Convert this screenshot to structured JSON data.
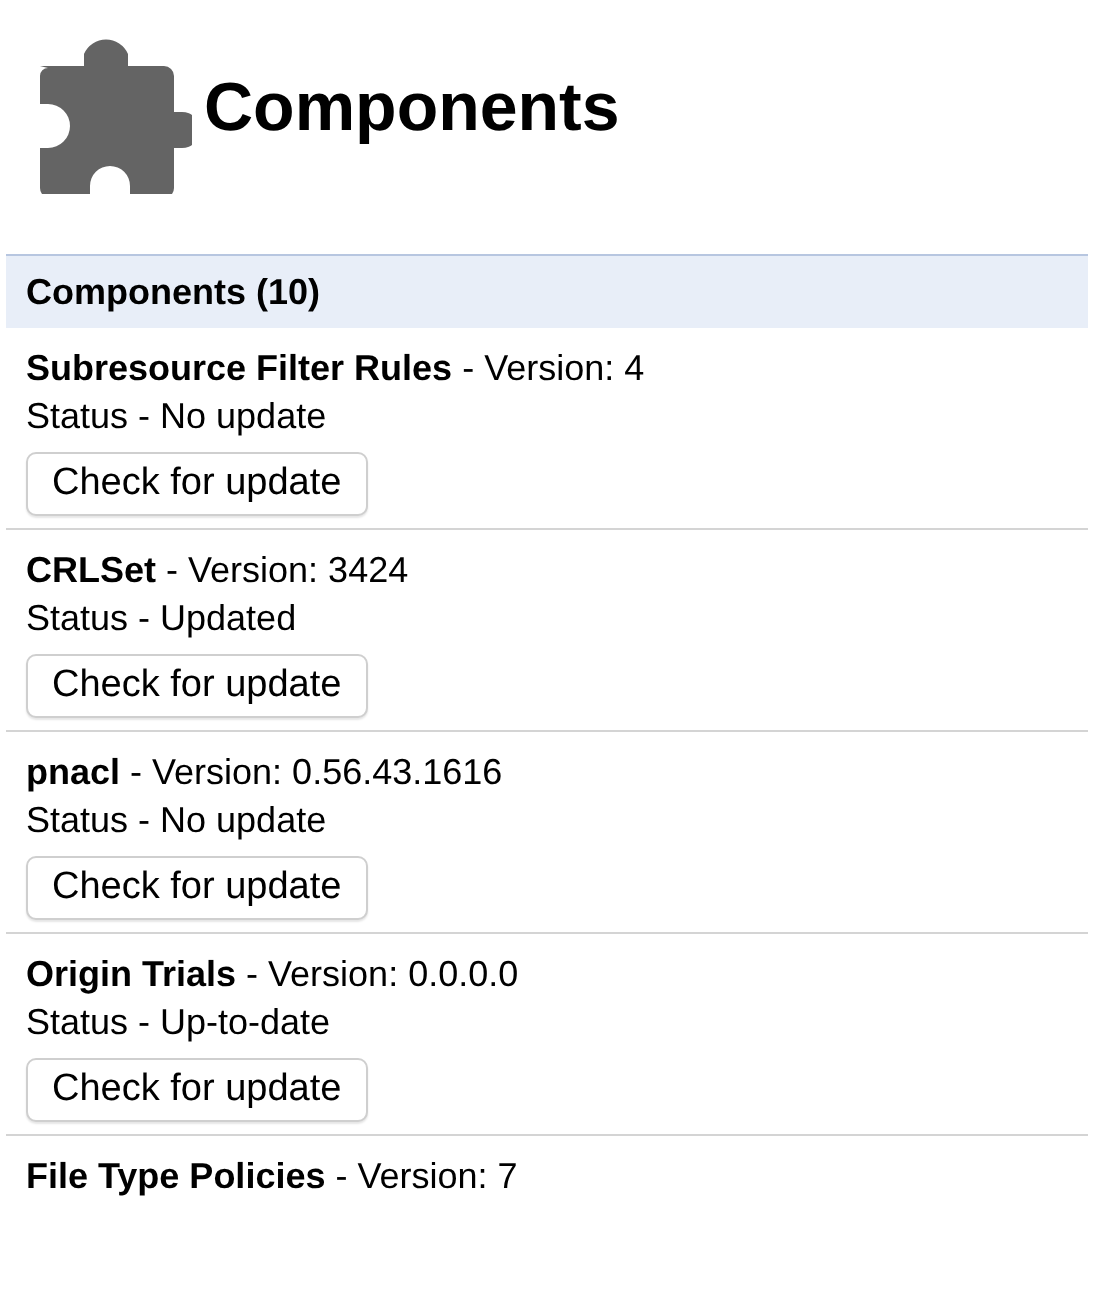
{
  "page_title": "Components",
  "section": {
    "heading": "Components (10)"
  },
  "components": [
    {
      "title": "**Subresource Filter Rules** - Version: 4",
      "status": "Status - No update",
      "button": "Check for update"
    },
    {
      "title": "**CRLSet** - Version: 3424",
      "status": "Status - Updated",
      "button": "Check for update"
    },
    {
      "title": "**pnacl** - Version: 0.56.43.1616",
      "status": "Status - No update",
      "button": "Check for update"
    },
    {
      "title": "**Origin Trials** - Version: 0.0.0.0",
      "status": "Status - Up-to-date",
      "button": "Check for update"
    },
    {
      "title": "**File Type Policies** - Version: 7"
    }
  ]
}
